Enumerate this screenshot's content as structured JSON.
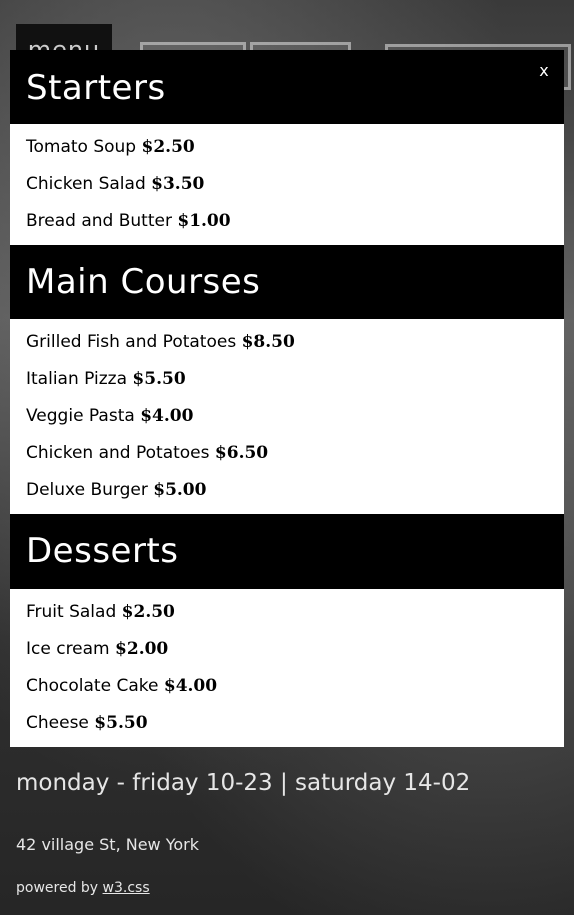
{
  "nav": {
    "menu_label": "menu"
  },
  "modal": {
    "close_label": "x"
  },
  "sections": [
    {
      "title": "Starters",
      "items": [
        {
          "name": "Tomato Soup",
          "price": "$2.50"
        },
        {
          "name": "Chicken Salad",
          "price": "$3.50"
        },
        {
          "name": "Bread and Butter",
          "price": "$1.00"
        }
      ]
    },
    {
      "title": "Main Courses",
      "items": [
        {
          "name": "Grilled Fish and Potatoes",
          "price": "$8.50"
        },
        {
          "name": "Italian Pizza",
          "price": "$5.50"
        },
        {
          "name": "Veggie Pasta",
          "price": "$4.00"
        },
        {
          "name": "Chicken and Potatoes",
          "price": "$6.50"
        },
        {
          "name": "Deluxe Burger",
          "price": "$5.00"
        }
      ]
    },
    {
      "title": "Desserts",
      "items": [
        {
          "name": "Fruit Salad",
          "price": "$2.50"
        },
        {
          "name": "Ice cream",
          "price": "$2.00"
        },
        {
          "name": "Chocolate Cake",
          "price": "$4.00"
        },
        {
          "name": "Cheese",
          "price": "$5.50"
        }
      ]
    }
  ],
  "footer": {
    "hours": "monday - friday 10-23 | saturday 14-02",
    "address": "42 village St, New York",
    "powered_prefix": "powered by",
    "powered_link": "w3.css"
  }
}
